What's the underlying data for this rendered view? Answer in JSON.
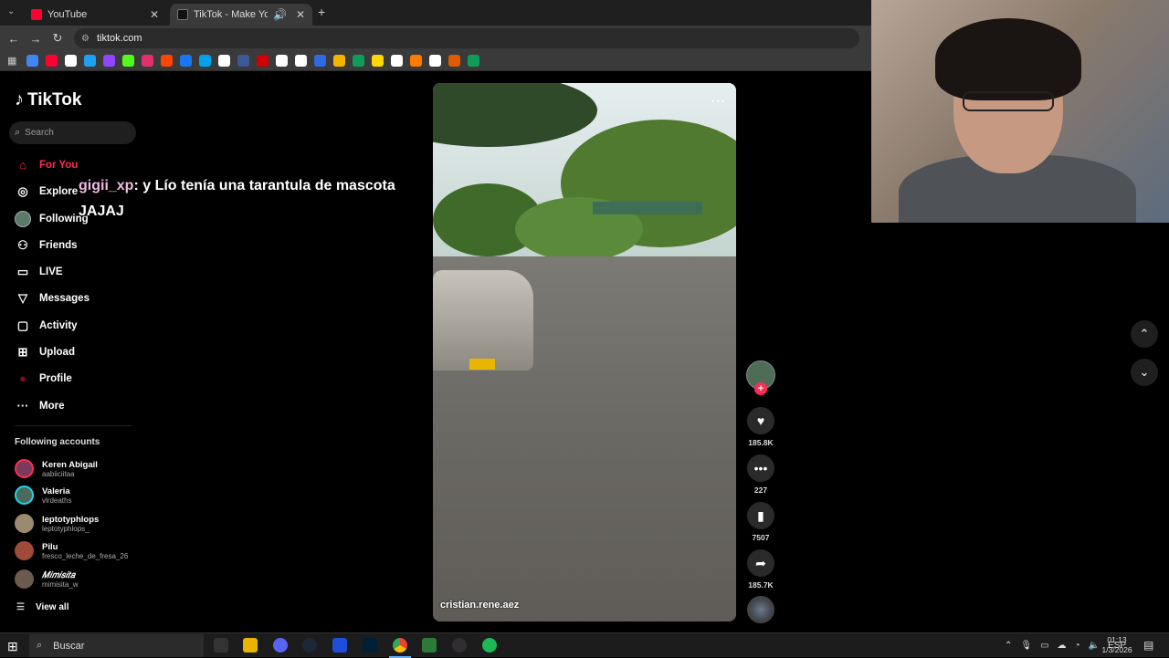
{
  "browser": {
    "tabs": [
      {
        "title": "YouTube",
        "favicon_color": "#ff0033"
      },
      {
        "title": "TikTok - Make Your Day",
        "favicon_color": "#000000"
      }
    ],
    "url": "tiktok.com",
    "bookmark_colors": [
      "#4285f4",
      "#ff0033",
      "#ffffff",
      "#1da1f2",
      "#9146ff",
      "#53fc18",
      "#e1306c",
      "#ff4500",
      "#1877f2",
      "#00a2ed",
      "#ffffff",
      "#3b5998",
      "#d00000",
      "#ffffff",
      "#ffffff",
      "#2d6ae3",
      "#f4b400",
      "#0f9d58",
      "#ffd600",
      "#ffffff",
      "#ff7a00",
      "#ffffff",
      "#e05a00",
      "#0f9d58"
    ]
  },
  "tiktok": {
    "logo_text": "TikTok",
    "search_placeholder": "Search",
    "menu": [
      {
        "label": "For You",
        "icon": "home-icon"
      },
      {
        "label": "Explore",
        "icon": "compass-icon"
      },
      {
        "label": "Following",
        "icon": "following-avatar-icon"
      },
      {
        "label": "Friends",
        "icon": "friends-icon"
      },
      {
        "label": "LIVE",
        "icon": "live-icon"
      },
      {
        "label": "Messages",
        "icon": "messages-icon"
      },
      {
        "label": "Activity",
        "icon": "activity-icon"
      },
      {
        "label": "Upload",
        "icon": "upload-icon"
      },
      {
        "label": "Profile",
        "icon": "profile-icon"
      },
      {
        "label": "More",
        "icon": "more-icon"
      }
    ],
    "following_title": "Following accounts",
    "accounts": [
      {
        "name": "Keren Abigail",
        "username": "aabiiciitaa"
      },
      {
        "name": "Valeria",
        "username": "vlrdeaths"
      },
      {
        "name": "leptotyphlops",
        "username": "leptotyphlops_"
      },
      {
        "name": "Pilu",
        "username": "fresco_leche_de_fresa_26"
      },
      {
        "name": "𝑀𝑖𝑚𝑖𝑠𝑖𝑡𝑎",
        "username": "mimisita_w"
      }
    ],
    "view_all": "View all",
    "video": {
      "author": "cristian.rene.aez"
    },
    "actions": {
      "likes": "185.8K",
      "comments": "227",
      "saves": "7507",
      "shares": "185.7K"
    }
  },
  "chat_overlay": {
    "user": "gigii_xp",
    "message": ": y Lío tenía una tarantula de mascota JAJAJ"
  },
  "taskbar": {
    "search_placeholder": "Buscar",
    "language": "ESP",
    "time": "01:13",
    "date": "1/3/2026"
  }
}
